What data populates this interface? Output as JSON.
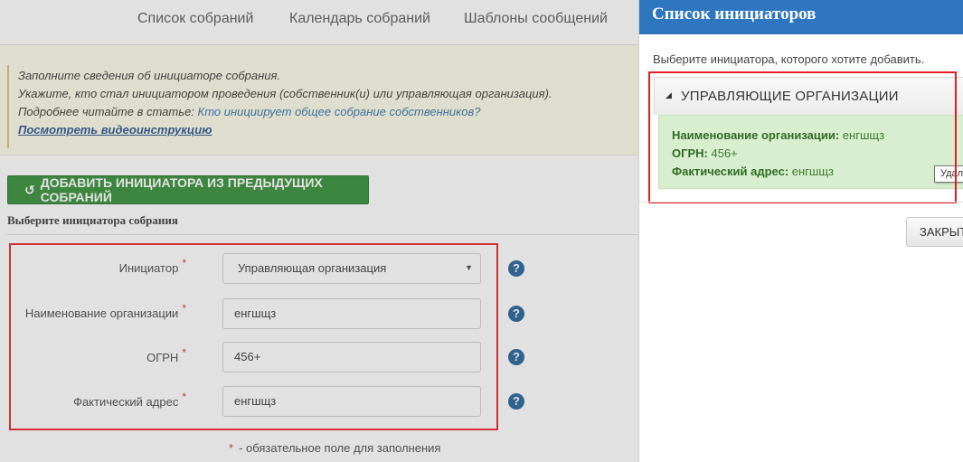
{
  "topnav": {
    "items": [
      "Список собраний",
      "Календарь собраний",
      "Шаблоны сообщений"
    ]
  },
  "info": {
    "line1": "Заполните сведения об инициаторе собрания.",
    "line2": "Укажите, кто стал инициатором проведения (собственник(и) или управляющая организация).",
    "line3_prefix": "Подробнее читайте в статье: ",
    "line3_link": "Кто инициирует общее собрание собственников?",
    "video_link": "Посмотреть видеоинструкцию"
  },
  "add_button": {
    "icon": "history-icon",
    "label": "ДОБАВИТЬ ИНИЦИАТОРА ИЗ ПРЕДЫДУЩИХ СОБРАНИЙ"
  },
  "section_title": "Выберите инициатора собрания",
  "form": {
    "initiator_label": "Инициатор",
    "initiator_value": "Управляющая организация",
    "org_name_label": "Наименование организации",
    "org_name_value": "енгшщз",
    "ogrn_label": "ОГРН",
    "ogrn_value": "456+",
    "address_label": "Фактический адрес",
    "address_value": "енгшщз",
    "required_mark": "*",
    "help_glyph": "?",
    "required_note": "- обязательное поле для заполнения"
  },
  "modal": {
    "title": "Список инициаторов",
    "subtitle": "Выберите инициатора, которого хотите добавить.",
    "group_label": "УПРАВЛЯЮЩИЕ ОРГАНИЗАЦИИ",
    "entry": {
      "name_key": "Наименование организации:",
      "name_value": " енгшщз",
      "ogrn_key": "ОГРН:",
      "ogrn_value": " 456+",
      "address_key": "Фактический адрес:",
      "address_value": " енгшщз"
    },
    "tooltip": "Удалить",
    "close_label": "ЗАКРЫТЬ"
  },
  "colors": {
    "modal_header": "#2f76c0",
    "green_button": "#2e8b30",
    "entry_bg": "#d7efcf",
    "highlight_frame": "#e31e24",
    "help_icon": "#1d5d95"
  }
}
